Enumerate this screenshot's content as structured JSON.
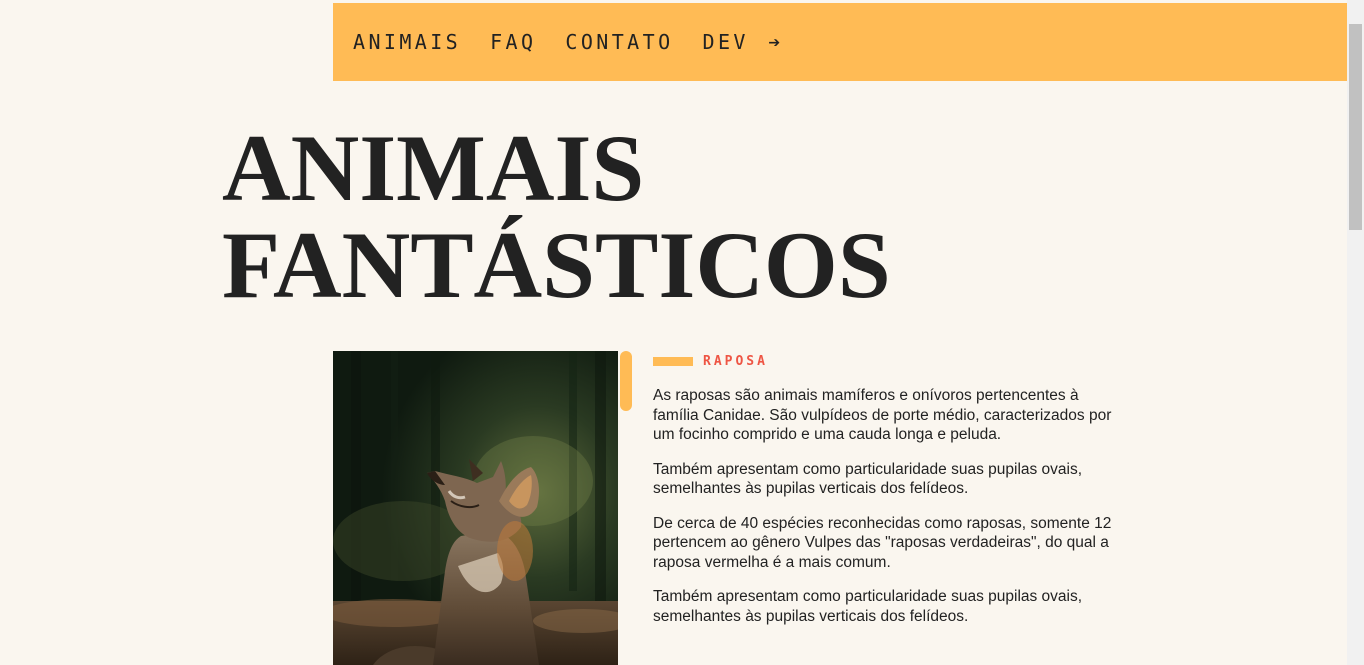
{
  "nav": {
    "items": [
      {
        "label": "ANIMAIS"
      },
      {
        "label": "FAQ"
      },
      {
        "label": "CONTATO"
      },
      {
        "label": "DEV"
      }
    ],
    "dev_arrow": "➔"
  },
  "page_title": {
    "line1": "ANIMAIS",
    "line2": "FANTÁSTICOS"
  },
  "gallery": {
    "image_alt": "Raposa",
    "colors": {
      "accent": "#ffbb55"
    }
  },
  "section": {
    "label": "RAPOSA",
    "paragraphs": [
      "As raposas são animais mamíferos e onívoros pertencentes à família Canidae. São vulpídeos de porte médio, caracterizados por um focinho comprido e uma cauda longa e peluda.",
      "Também apresentam como particularidade suas pupilas ovais, semelhantes às pupilas verticais dos felídeos.",
      "De cerca de 40 espécies reconhecidas como raposas, somente 12 pertencem ao gênero Vulpes das \"raposas verdadeiras\", do qual a raposa vermelha é a mais comum.",
      "Também apresentam como particularidade suas pupilas ovais, semelhantes às pupilas verticais dos felídeos."
    ]
  },
  "colors": {
    "background": "#faf6ef",
    "nav_background": "#ffbb55",
    "text": "#222222",
    "label": "#ee5544"
  }
}
